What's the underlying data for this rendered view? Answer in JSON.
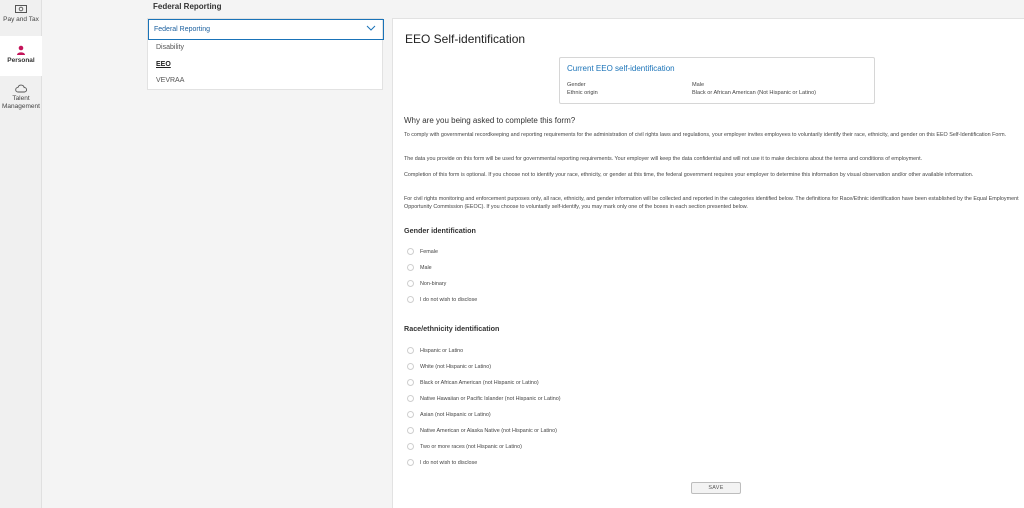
{
  "nav": {
    "items": [
      {
        "label": "Pay and Tax",
        "icon": "money-icon"
      },
      {
        "label": "Personal",
        "icon": "person-icon"
      },
      {
        "label": "Talent Management",
        "icon": "cloud-icon"
      }
    ],
    "accent": "#c4145a"
  },
  "section_title": "Federal Reporting",
  "subnav": {
    "selected": "Federal Reporting",
    "items": [
      "Disability",
      "EEO",
      "VEVRAA"
    ],
    "active_item": "EEO"
  },
  "page": {
    "title": "EEO Self-identification",
    "current": {
      "title": "Current EEO self-identification",
      "rows": [
        {
          "label": "Gender",
          "value": "Male"
        },
        {
          "label": "Ethnic origin",
          "value": "Black or African American (Not Hispanic or Latino)"
        }
      ]
    },
    "why_title": "Why are you being asked to complete this form?",
    "paragraphs": [
      "To comply with governmental recordkeeping and reporting requirements for the administration of civil rights laws and regulations, your employer invites employees to voluntarily identify their race, ethnicity, and gender on this EEO Self-Identification Form.",
      "The data you provide on this form will be used for governmental reporting requirements. Your employer will keep the data confidential and will not use it to make decisions about the terms and conditions of employment.",
      "Completion of this form is optional. If you choose not to identify your race, ethnicity, or gender at this time, the federal government requires your employer to determine this information by visual observation and/or other available information.",
      "For civil rights monitoring and enforcement purposes only, all race, ethnicity, and gender information will be collected and reported in the categories identified below. The definitions for Race/Ethnic identification have been established by the Equal Employment Opportunity Commission (EEOC). If you choose to voluntarily self-identify, you may mark only one of the boxes in each section presented below."
    ],
    "gender": {
      "title": "Gender identification",
      "options": [
        "Female",
        "Male",
        "Non-binary",
        "I do not wish to disclose"
      ]
    },
    "race": {
      "title": "Race/ethnicity identification",
      "options": [
        "Hispanic or Latino",
        "White (not Hispanic or Latino)",
        "Black or African American (not Hispanic or Latino)",
        "Native Hawaiian or Pacific Islander (not Hispanic or Latino)",
        "Asian (not Hispanic or Latino)",
        "Native American or Alaska Native (not Hispanic or Latino)",
        "Two or more races (not Hispanic or Latino)",
        "I do not wish to disclose"
      ]
    },
    "save_label": "SAVE"
  },
  "colors": {
    "link_blue": "#1a73b8",
    "border": "#e2e2e2"
  }
}
